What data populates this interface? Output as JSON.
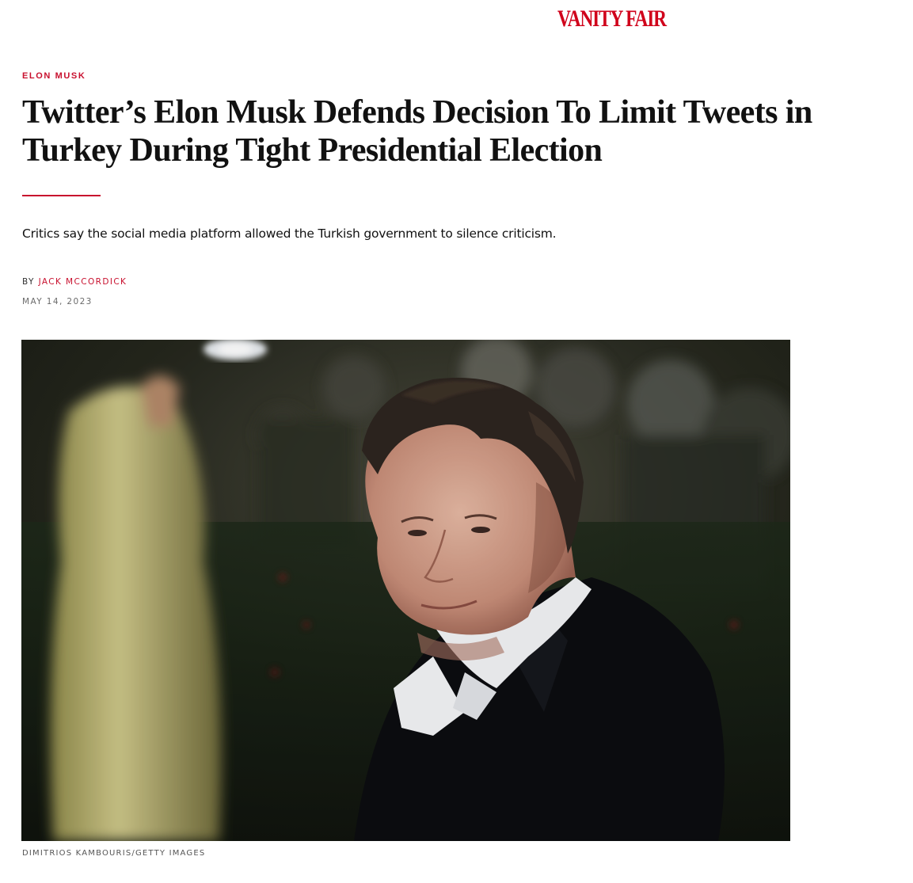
{
  "header": {
    "logo_text": "VANITY FAIR",
    "brand_color": "#c8102e"
  },
  "article": {
    "rubric": "ELON MUSK",
    "headline": "Twitter’s Elon Musk Defends Decision To Limit Tweets in Turkey During Tight Presidential Election",
    "dek": "Critics say the social media platform allowed the Turkish government to silence criticism.",
    "byline_prefix": "BY",
    "author": "JACK MCCORDICK",
    "date": "MAY 14, 2023"
  },
  "hero_image": {
    "subject": "photo-elon-musk-at-event",
    "credit": "DIMITRIOS KAMBOURIS/GETTY IMAGES"
  }
}
